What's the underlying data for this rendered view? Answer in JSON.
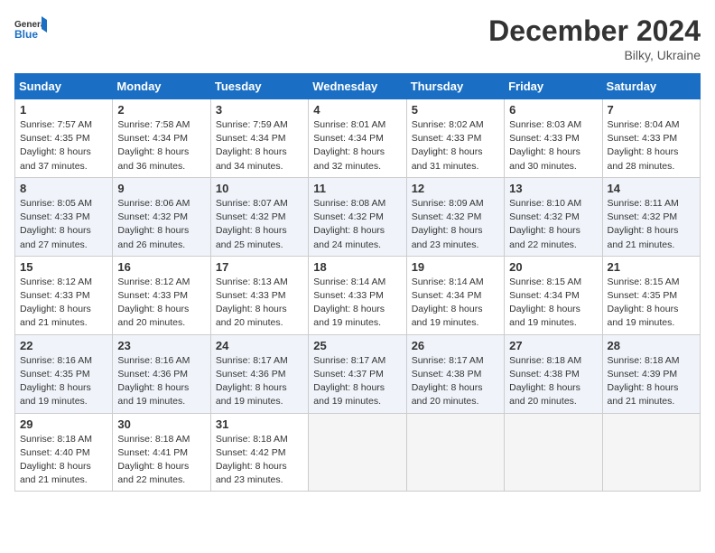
{
  "header": {
    "logo_line1": "General",
    "logo_line2": "Blue",
    "month": "December 2024",
    "location": "Bilky, Ukraine"
  },
  "weekdays": [
    "Sunday",
    "Monday",
    "Tuesday",
    "Wednesday",
    "Thursday",
    "Friday",
    "Saturday"
  ],
  "weeks": [
    [
      {
        "day": "1",
        "info": "Sunrise: 7:57 AM\nSunset: 4:35 PM\nDaylight: 8 hours\nand 37 minutes."
      },
      {
        "day": "2",
        "info": "Sunrise: 7:58 AM\nSunset: 4:34 PM\nDaylight: 8 hours\nand 36 minutes."
      },
      {
        "day": "3",
        "info": "Sunrise: 7:59 AM\nSunset: 4:34 PM\nDaylight: 8 hours\nand 34 minutes."
      },
      {
        "day": "4",
        "info": "Sunrise: 8:01 AM\nSunset: 4:34 PM\nDaylight: 8 hours\nand 32 minutes."
      },
      {
        "day": "5",
        "info": "Sunrise: 8:02 AM\nSunset: 4:33 PM\nDaylight: 8 hours\nand 31 minutes."
      },
      {
        "day": "6",
        "info": "Sunrise: 8:03 AM\nSunset: 4:33 PM\nDaylight: 8 hours\nand 30 minutes."
      },
      {
        "day": "7",
        "info": "Sunrise: 8:04 AM\nSunset: 4:33 PM\nDaylight: 8 hours\nand 28 minutes."
      }
    ],
    [
      {
        "day": "8",
        "info": "Sunrise: 8:05 AM\nSunset: 4:33 PM\nDaylight: 8 hours\nand 27 minutes."
      },
      {
        "day": "9",
        "info": "Sunrise: 8:06 AM\nSunset: 4:32 PM\nDaylight: 8 hours\nand 26 minutes."
      },
      {
        "day": "10",
        "info": "Sunrise: 8:07 AM\nSunset: 4:32 PM\nDaylight: 8 hours\nand 25 minutes."
      },
      {
        "day": "11",
        "info": "Sunrise: 8:08 AM\nSunset: 4:32 PM\nDaylight: 8 hours\nand 24 minutes."
      },
      {
        "day": "12",
        "info": "Sunrise: 8:09 AM\nSunset: 4:32 PM\nDaylight: 8 hours\nand 23 minutes."
      },
      {
        "day": "13",
        "info": "Sunrise: 8:10 AM\nSunset: 4:32 PM\nDaylight: 8 hours\nand 22 minutes."
      },
      {
        "day": "14",
        "info": "Sunrise: 8:11 AM\nSunset: 4:32 PM\nDaylight: 8 hours\nand 21 minutes."
      }
    ],
    [
      {
        "day": "15",
        "info": "Sunrise: 8:12 AM\nSunset: 4:33 PM\nDaylight: 8 hours\nand 21 minutes."
      },
      {
        "day": "16",
        "info": "Sunrise: 8:12 AM\nSunset: 4:33 PM\nDaylight: 8 hours\nand 20 minutes."
      },
      {
        "day": "17",
        "info": "Sunrise: 8:13 AM\nSunset: 4:33 PM\nDaylight: 8 hours\nand 20 minutes."
      },
      {
        "day": "18",
        "info": "Sunrise: 8:14 AM\nSunset: 4:33 PM\nDaylight: 8 hours\nand 19 minutes."
      },
      {
        "day": "19",
        "info": "Sunrise: 8:14 AM\nSunset: 4:34 PM\nDaylight: 8 hours\nand 19 minutes."
      },
      {
        "day": "20",
        "info": "Sunrise: 8:15 AM\nSunset: 4:34 PM\nDaylight: 8 hours\nand 19 minutes."
      },
      {
        "day": "21",
        "info": "Sunrise: 8:15 AM\nSunset: 4:35 PM\nDaylight: 8 hours\nand 19 minutes."
      }
    ],
    [
      {
        "day": "22",
        "info": "Sunrise: 8:16 AM\nSunset: 4:35 PM\nDaylight: 8 hours\nand 19 minutes."
      },
      {
        "day": "23",
        "info": "Sunrise: 8:16 AM\nSunset: 4:36 PM\nDaylight: 8 hours\nand 19 minutes."
      },
      {
        "day": "24",
        "info": "Sunrise: 8:17 AM\nSunset: 4:36 PM\nDaylight: 8 hours\nand 19 minutes."
      },
      {
        "day": "25",
        "info": "Sunrise: 8:17 AM\nSunset: 4:37 PM\nDaylight: 8 hours\nand 19 minutes."
      },
      {
        "day": "26",
        "info": "Sunrise: 8:17 AM\nSunset: 4:38 PM\nDaylight: 8 hours\nand 20 minutes."
      },
      {
        "day": "27",
        "info": "Sunrise: 8:18 AM\nSunset: 4:38 PM\nDaylight: 8 hours\nand 20 minutes."
      },
      {
        "day": "28",
        "info": "Sunrise: 8:18 AM\nSunset: 4:39 PM\nDaylight: 8 hours\nand 21 minutes."
      }
    ],
    [
      {
        "day": "29",
        "info": "Sunrise: 8:18 AM\nSunset: 4:40 PM\nDaylight: 8 hours\nand 21 minutes."
      },
      {
        "day": "30",
        "info": "Sunrise: 8:18 AM\nSunset: 4:41 PM\nDaylight: 8 hours\nand 22 minutes."
      },
      {
        "day": "31",
        "info": "Sunrise: 8:18 AM\nSunset: 4:42 PM\nDaylight: 8 hours\nand 23 minutes."
      },
      {
        "day": "",
        "info": ""
      },
      {
        "day": "",
        "info": ""
      },
      {
        "day": "",
        "info": ""
      },
      {
        "day": "",
        "info": ""
      }
    ]
  ]
}
